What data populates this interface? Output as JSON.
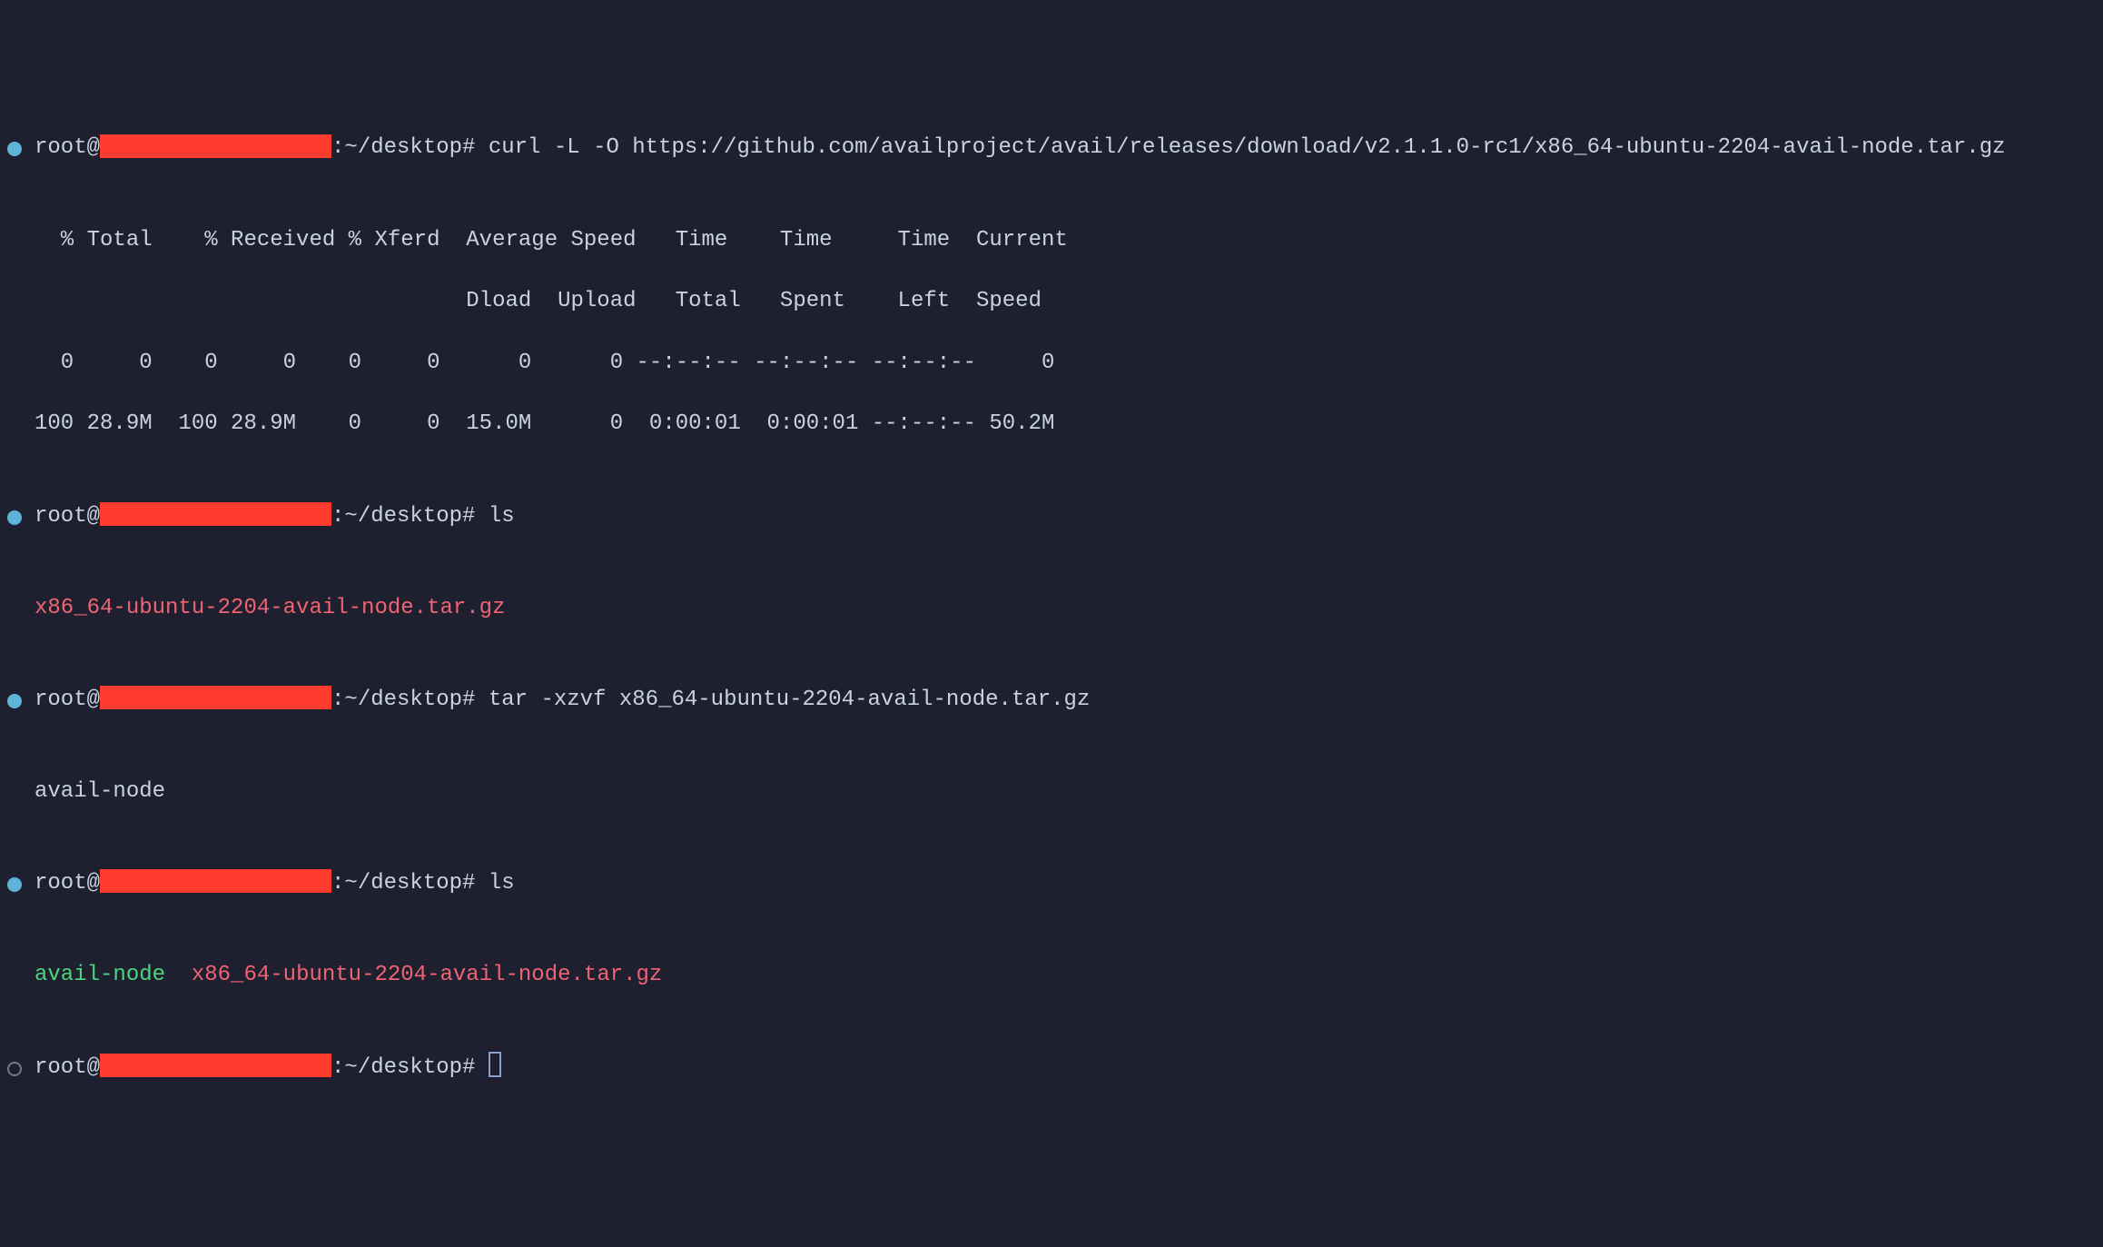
{
  "prompts": {
    "p1": {
      "user": "root@",
      "path": ":~/desktop# ",
      "cmd": "curl -L -O https://github.com/availproject/avail/releases/download/v2.1.1.0-rc1/x86_64-ubuntu-2204-avail-node.tar.gz",
      "redactWidth": "255"
    },
    "p2": {
      "user": "root@",
      "path": ":~/desktop# ",
      "cmd": "ls",
      "redactWidth": "255"
    },
    "p3": {
      "user": "root@",
      "path": ":~/desktop# ",
      "cmd": "tar -xzvf x86_64-ubuntu-2204-avail-node.tar.gz",
      "redactWidth": "255"
    },
    "p4": {
      "user": "root@",
      "path": ":~/desktop# ",
      "cmd": "ls",
      "redactWidth": "255"
    },
    "p5": {
      "user": "root@",
      "path": ":~/desktop# ",
      "cmd": "",
      "redactWidth": "255"
    }
  },
  "curlOutput": {
    "header1": "  % Total    % Received % Xferd  Average Speed   Time    Time     Time  Current",
    "header2": "                                 Dload  Upload   Total   Spent    Left  Speed",
    "row1": "  0     0    0     0    0     0      0      0 --:--:-- --:--:-- --:--:--     0",
    "row2": "100 28.9M  100 28.9M    0     0  15.0M      0  0:00:01  0:00:01 --:--:-- 50.2M"
  },
  "files": {
    "tarGz": "x86_64-ubuntu-2204-avail-node.tar.gz",
    "availNode": "avail-node"
  },
  "tarOutput": "avail-node",
  "spacer": "  "
}
